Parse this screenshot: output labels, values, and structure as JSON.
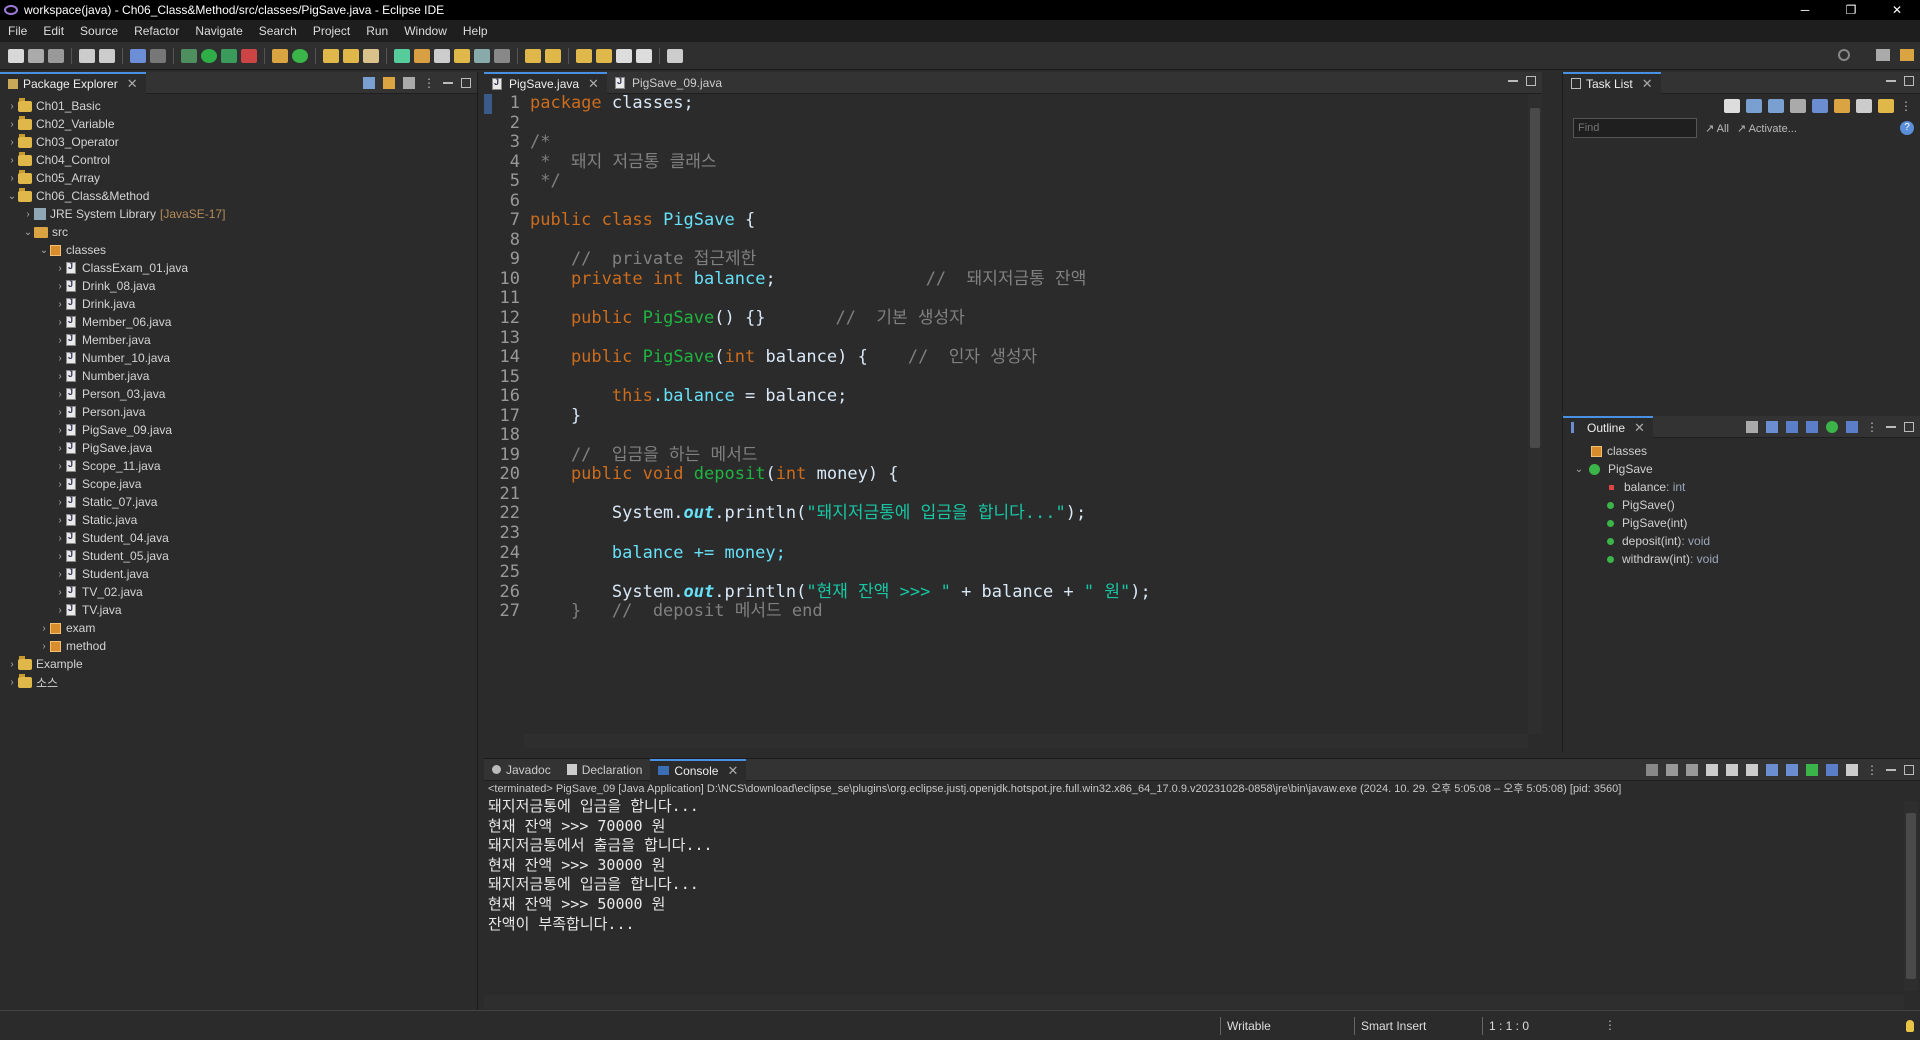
{
  "window": {
    "title": "workspace(java) - Ch06_Class&Method/src/classes/PigSave.java - Eclipse IDE",
    "min": "─",
    "restore": "❐",
    "close": "✕"
  },
  "menu": [
    "File",
    "Edit",
    "Source",
    "Refactor",
    "Navigate",
    "Search",
    "Project",
    "Run",
    "Window",
    "Help"
  ],
  "package_explorer": {
    "tab": "Package Explorer",
    "projects_top": [
      "Ch01_Basic",
      "Ch02_Variable",
      "Ch03_Operator",
      "Ch04_Control",
      "Ch05_Array",
      "Ch06_Class&Method"
    ],
    "jre": "JRE System Library",
    "jre_ver": "[JavaSE-17]",
    "src": "src",
    "pkg_classes": "classes",
    "files": [
      "ClassExam_01.java",
      "Drink_08.java",
      "Drink.java",
      "Member_06.java",
      "Member.java",
      "Number_10.java",
      "Number.java",
      "Person_03.java",
      "Person.java",
      "PigSave_09.java",
      "PigSave.java",
      "Scope_11.java",
      "Scope.java",
      "Static_07.java",
      "Static.java",
      "Student_04.java",
      "Student_05.java",
      "Student.java",
      "TV_02.java",
      "TV.java"
    ],
    "pkg_exam": "exam",
    "pkg_method": "method",
    "projects_bottom": [
      "Example",
      "소스"
    ]
  },
  "editor": {
    "tabs": [
      "PigSave.java",
      "PigSave_09.java"
    ],
    "line_numbers": [
      "1",
      "2",
      "3",
      "4",
      "5",
      "6",
      "7",
      "8",
      "9",
      "10",
      "11",
      "12",
      "13",
      "14",
      "15",
      "16",
      "17",
      "18",
      "19",
      "20",
      "21",
      "22",
      "23",
      "24",
      "25",
      "26",
      "27"
    ],
    "code": {
      "l1_kw": "package",
      "l1_rest": " classes;",
      "l3": "/*",
      "l4": " *  돼지 저금통 클래스",
      "l5": " */",
      "l7_kw": "public class",
      "l7_ty": "PigSave",
      "l7_rest": " {",
      "l9": "    //  private 접근제한",
      "l10_kw": "    private int",
      "l10_fld": "balance",
      "l10_rest": ";",
      "l10_cm": "//  돼지저금통 잔액",
      "l12_kw": "    public",
      "l12_ty": "PigSave",
      "l12_rest": "() {}",
      "l12_cm": "//  기본 생성자",
      "l14_kw": "    public",
      "l14_ty": "PigSave",
      "l14_p1": "(",
      "l14_kw2": "int",
      "l14_p2": " balance) {",
      "l14_cm": "//  인자 생성자",
      "l16_kw": "        this",
      "l16_fld": ".balance",
      "l16_rest": " = balance;",
      "l17": "    }",
      "l19": "    //  입금을 하는 메서드",
      "l20_kw": "    public void",
      "l20_ty": "deposit",
      "l20_p1": "(",
      "l20_kw2": "int",
      "l20_p2": " money) {",
      "l22_a": "        System.",
      "l22_out": "out",
      "l22_b": ".println(",
      "l22_str": "\"돼지저금통에 입금을 합니다...\"",
      "l22_c": ");",
      "l24": "        balance += money;",
      "l26_a": "        System.",
      "l26_out": "out",
      "l26_b": ".println(",
      "l26_str1": "\"현재 잔액 >>> \"",
      "l26_mid": " + balance + ",
      "l26_str2": "\" 원\"",
      "l26_c": ");",
      "l27": "    }   //  deposit 메서드 end"
    }
  },
  "task_list": {
    "tab": "Task List",
    "find_placeholder": "Find",
    "all": "All",
    "activate": "Activate..."
  },
  "outline": {
    "tab": "Outline",
    "pkg": "classes",
    "class": "PigSave",
    "members": [
      {
        "name": "balance",
        "ret": " : int"
      },
      {
        "name": "PigSave()",
        "ret": ""
      },
      {
        "name": "PigSave(int)",
        "ret": ""
      },
      {
        "name": "deposit(int)",
        "ret": " : void"
      },
      {
        "name": "withdraw(int)",
        "ret": " : void"
      }
    ]
  },
  "bottom": {
    "tabs": [
      "Javadoc",
      "Declaration",
      "Console"
    ],
    "terminated": "<terminated> PigSave_09 [Java Application] D:\\NCS\\download\\eclipse_se\\plugins\\org.eclipse.justj.openjdk.hotspot.jre.full.win32.x86_64_17.0.9.v20231028-0858\\jre\\bin\\javaw.exe  (2024. 10. 29. 오후 5:05:08 – 오후 5:05:08) [pid: 3560]",
    "output": [
      "돼지저금통에 입금을 합니다...",
      "현재 잔액 >>> 70000 원",
      "돼지저금통에서 출금을 합니다...",
      "현재 잔액 >>> 30000 원",
      "돼지저금통에 입금을 합니다...",
      "현재 잔액 >>> 50000 원",
      "잔액이 부족합니다..."
    ]
  },
  "status": {
    "writable": "Writable",
    "insert": "Smart Insert",
    "pos": "1 : 1 : 0"
  }
}
